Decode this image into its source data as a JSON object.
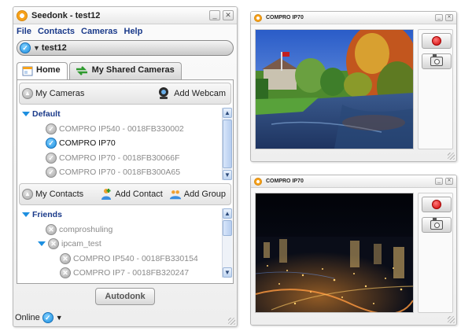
{
  "main_window": {
    "title": "Seedonk - test12",
    "menu": [
      "File",
      "Contacts",
      "Cameras",
      "Help"
    ],
    "user": "test12",
    "tabs": {
      "home": "Home",
      "shared": "My Shared Cameras"
    },
    "cameras_section": {
      "header": "My Cameras",
      "action": "Add Webcam",
      "group": "Default",
      "items": [
        {
          "label": "COMPRO IP540 - 0018FB330002",
          "online": false
        },
        {
          "label": "COMPRO IP70",
          "online": true
        },
        {
          "label": "COMPRO IP70 - 0018FB30066F",
          "online": false
        },
        {
          "label": "COMPRO IP70 - 0018FB300A65",
          "online": false
        }
      ]
    },
    "contacts_section": {
      "header": "My Contacts",
      "add_contact": "Add Contact",
      "add_group": "Add Group",
      "group": "Friends",
      "items": [
        {
          "label": "comproshuling",
          "level": 1,
          "expanded": false
        },
        {
          "label": "ipcam_test",
          "level": 1,
          "expanded": true
        },
        {
          "label": "COMPRO IP540 - 0018FB330154",
          "level": 2
        },
        {
          "label": "COMPRO IP7 - 0018FB320247",
          "level": 2
        }
      ]
    },
    "autodonk_button": "Autodonk",
    "status": "Online"
  },
  "camera_windows": [
    {
      "title": "COMPRO IP70",
      "scene": "daytime park with river and autumn trees"
    },
    {
      "title": "COMPRO IP70",
      "scene": "night city skyline"
    }
  ],
  "colors": {
    "accent_blue": "#1d8fe0",
    "link_blue": "#1a3a8a",
    "record_red": "#d00000",
    "logo_orange": "#f7a21b"
  }
}
